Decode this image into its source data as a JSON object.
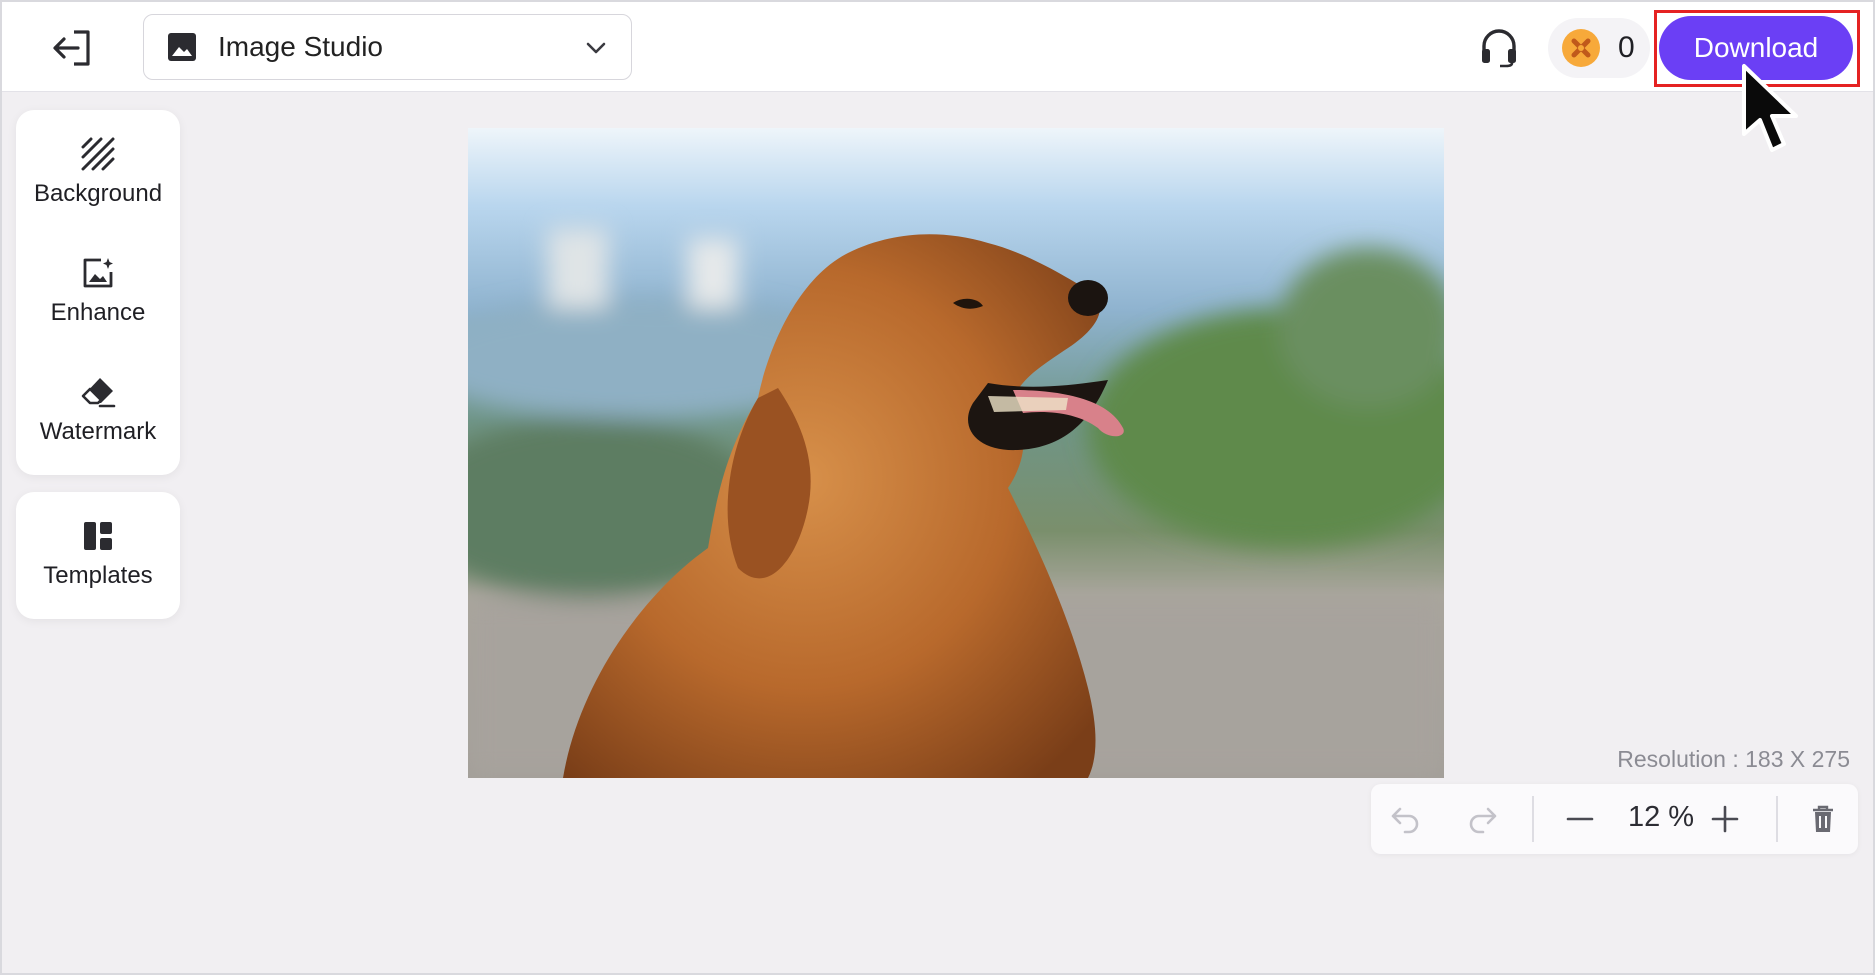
{
  "header": {
    "exit_icon": "exit-icon",
    "studio_name": "Image Studio",
    "studio_icon": "image-icon",
    "support_icon": "headset-icon",
    "credits_count": "0",
    "credits_icon": "coin-icon",
    "download_label": "Download"
  },
  "sidebar": {
    "tools": [
      {
        "label": "Background",
        "icon": "background-pattern-icon"
      },
      {
        "label": "Enhance",
        "icon": "enhance-image-icon"
      },
      {
        "label": "Watermark",
        "icon": "eraser-icon"
      }
    ],
    "templates": {
      "label": "Templates",
      "icon": "templates-layout-icon"
    }
  },
  "canvas": {
    "resolution": "Resolution : 183 X 275",
    "zoom": "12 %"
  },
  "colors": {
    "accent": "#6b3ff5",
    "highlight": "#e52222",
    "coin": "#f7a93a"
  }
}
